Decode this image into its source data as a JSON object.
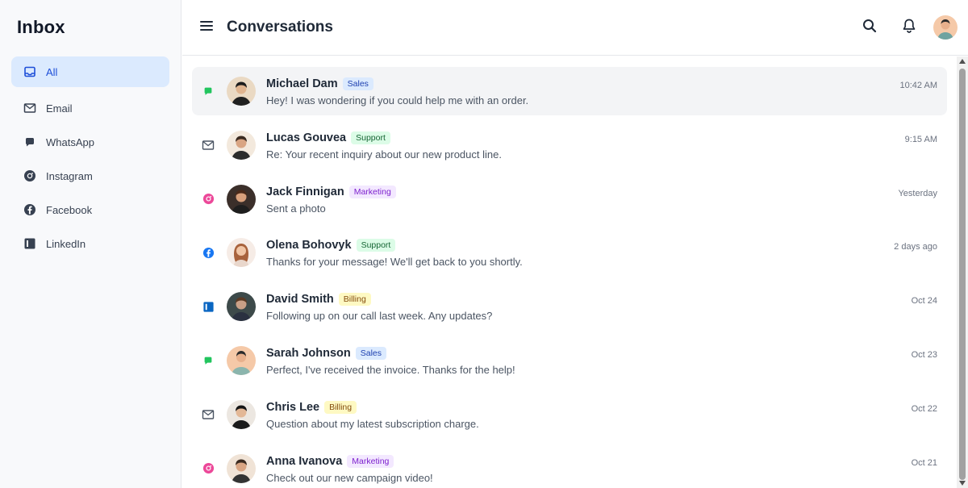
{
  "sidebar": {
    "title": "Inbox",
    "items": [
      {
        "label": "All",
        "icon": "inbox-icon",
        "active": true
      },
      {
        "label": "Email",
        "icon": "mail-icon"
      },
      {
        "label": "WhatsApp",
        "icon": "whatsapp-icon"
      },
      {
        "label": "Instagram",
        "icon": "instagram-icon"
      },
      {
        "label": "Facebook",
        "icon": "facebook-icon"
      },
      {
        "label": "LinkedIn",
        "icon": "linkedin-icon"
      }
    ]
  },
  "header": {
    "title": "Conversations",
    "icons": [
      "menu-icon",
      "search-icon",
      "bell-icon",
      "user-avatar"
    ]
  },
  "colors": {
    "accent": "#1d4ed8",
    "active_bg": "#dbeafe",
    "whatsapp": "#22c55e",
    "instagram": "#ec4899",
    "facebook": "#1877f2",
    "linkedin": "#0a66c2"
  },
  "conversations": [
    {
      "name": "Michael Dam",
      "tag": "Sales",
      "preview": "Hey! I was wondering if you could help me with an order.",
      "time": "10:42 AM",
      "channel": "whatsapp-icon",
      "selected": true
    },
    {
      "name": "Lucas Gouvea",
      "tag": "Support",
      "preview": "Re: Your recent inquiry about our new product line.",
      "time": "9:15 AM",
      "channel": "mail-icon"
    },
    {
      "name": "Jack Finnigan",
      "tag": "Marketing",
      "preview": "Sent a photo",
      "time": "Yesterday",
      "channel": "instagram-icon"
    },
    {
      "name": "Olena Bohovyk",
      "tag": "Support",
      "preview": "Thanks for your message! We'll get back to you shortly.",
      "time": "2 days ago",
      "channel": "facebook-icon"
    },
    {
      "name": "David Smith",
      "tag": "Billing",
      "preview": "Following up on our call last week. Any updates?",
      "time": "Oct 24",
      "channel": "linkedin-icon"
    },
    {
      "name": "Sarah Johnson",
      "tag": "Sales",
      "preview": "Perfect, I've received the invoice. Thanks for the help!",
      "time": "Oct 23",
      "channel": "whatsapp-icon"
    },
    {
      "name": "Chris Lee",
      "tag": "Billing",
      "preview": "Question about my latest subscription charge.",
      "time": "Oct 22",
      "channel": "mail-icon"
    },
    {
      "name": "Anna Ivanova",
      "tag": "Marketing",
      "preview": "Check out our new campaign video!",
      "time": "Oct 21",
      "channel": "instagram-icon"
    }
  ]
}
